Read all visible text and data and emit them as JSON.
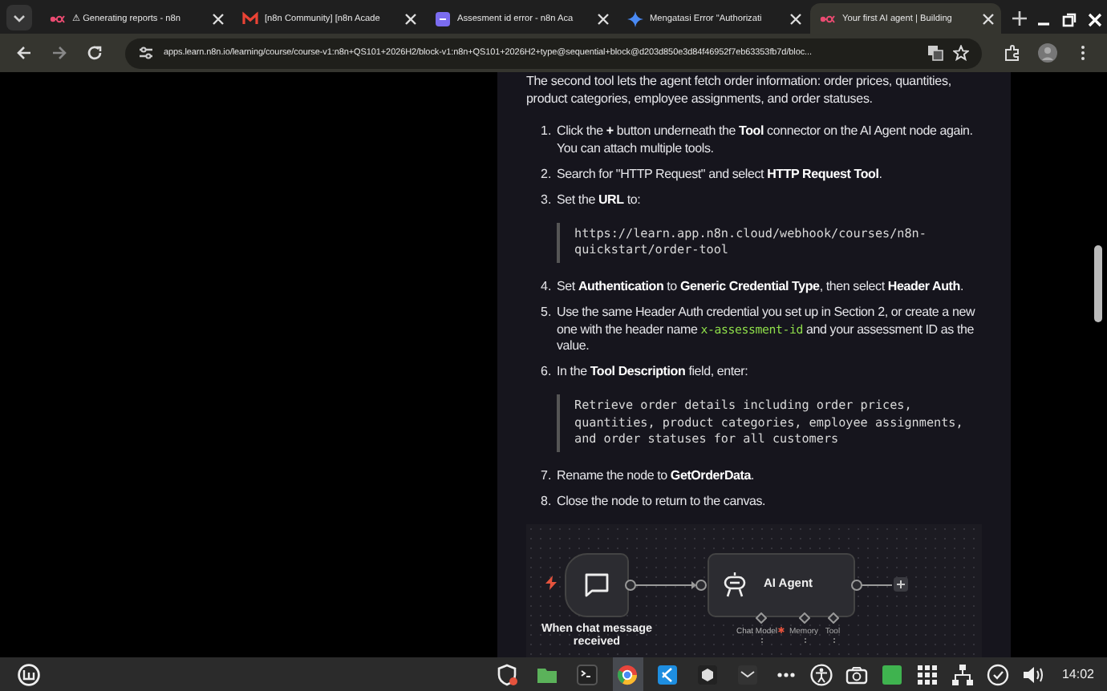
{
  "tabs": [
    {
      "title": "⚠ Generating reports - n8n",
      "selected": false
    },
    {
      "title": "[n8n Community] [n8n Acade",
      "selected": false
    },
    {
      "title": "Assesment id error - n8n Aca",
      "selected": false
    },
    {
      "title": "Mengatasi Error \"Authorizati",
      "selected": false
    },
    {
      "title": "Your first AI agent | Building",
      "selected": true
    }
  ],
  "address": {
    "url": "apps.learn.n8n.io/learning/course/course-v1:n8n+QS101+2026H2/block-v1:n8n+QS101+2026H2+type@sequential+block@d203d850e3d84f46952f7eb63353fb7d/bloc..."
  },
  "article": {
    "intro": "The second tool lets the agent fetch order information: order prices, quantities, product categories, employee assignments, and order statuses.",
    "steps": [
      {
        "number": "1.",
        "parts": [
          {
            "kind": "text",
            "text": "Click the **+** button underneath the **Tool** connector on the AI Agent node again. You can attach multiple tools."
          }
        ]
      },
      {
        "number": "2.",
        "parts": [
          {
            "kind": "text",
            "text": "Search for \"HTTP Request\" and select **HTTP Request Tool**."
          }
        ]
      },
      {
        "number": "3.",
        "parts": [
          {
            "kind": "text",
            "text": "Set the **URL** to:"
          }
        ],
        "code": "https://learn.app.n8n.cloud/webhook/courses/n8n-\nquickstart/order-tool"
      },
      {
        "number": "4.",
        "parts": [
          {
            "kind": "text",
            "text": "Set **Authentication** to **Generic Credential Type**, then select **Header Auth**."
          }
        ]
      },
      {
        "number": "5.",
        "parts": [
          {
            "kind": "text",
            "text": "Use the same Header Auth credential you set up in Section 2, or create a new one with the header name "
          },
          {
            "kind": "code",
            "text": "x-assessment-id"
          },
          {
            "kind": "text",
            "text": " and your assessment ID as the value."
          }
        ]
      },
      {
        "number": "6.",
        "parts": [
          {
            "kind": "text",
            "text": "In the **Tool Description** field, enter:"
          }
        ],
        "code": "Retrieve order details including order prices,\nquantities, product categories, employee assignments,\nand order statuses for all customers"
      },
      {
        "number": "7.",
        "parts": [
          {
            "kind": "text",
            "text": "Rename the node to **GetOrderData**."
          }
        ]
      },
      {
        "number": "8.",
        "parts": [
          {
            "kind": "text",
            "text": "Close the node to return to the canvas."
          }
        ]
      }
    ]
  },
  "workflow": {
    "trigger": {
      "label": "When chat message received"
    },
    "agent": {
      "title": "AI Agent",
      "connectors": [
        {
          "label": "Chat Model",
          "required": true
        },
        {
          "label": "Memory",
          "required": false
        },
        {
          "label": "Tool",
          "required": false
        }
      ]
    }
  },
  "taskbar": {
    "clock": "14:02",
    "apps": [
      {
        "kind": "shield",
        "active": false
      },
      {
        "kind": "folder",
        "active": false
      },
      {
        "kind": "terminal",
        "active": false
      },
      {
        "kind": "browser",
        "active": true
      },
      {
        "kind": "code",
        "active": false
      },
      {
        "kind": "cube",
        "active": false
      },
      {
        "kind": "mail",
        "active": false
      }
    ]
  }
}
